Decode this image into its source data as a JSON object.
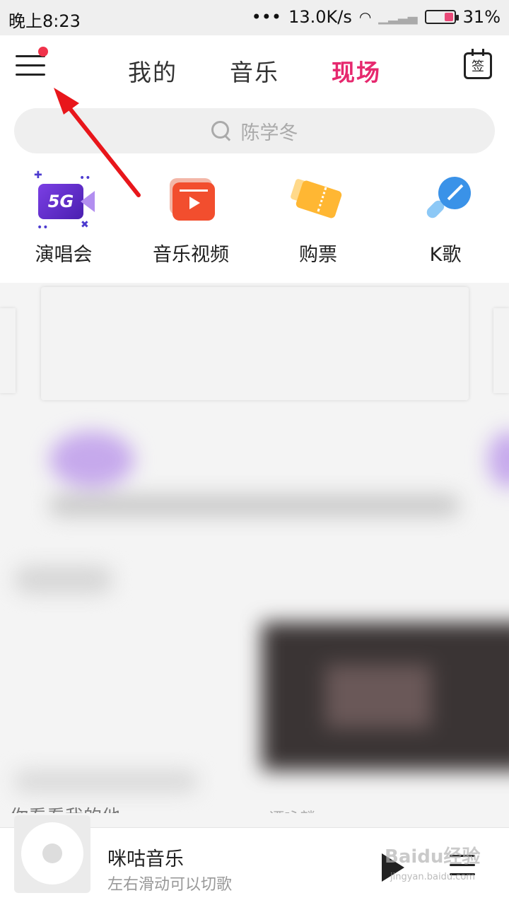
{
  "status_bar": {
    "time": "晚上8:23",
    "net_speed": "13.0K/s",
    "battery_percent": "31%",
    "battery_level": 0.31
  },
  "header": {
    "tabs": [
      {
        "label": "我的",
        "active": false
      },
      {
        "label": "音乐",
        "active": false
      },
      {
        "label": "现场",
        "active": true
      }
    ],
    "sign_label": "签",
    "accent_color": "#e6286e"
  },
  "search": {
    "placeholder": "陈学冬"
  },
  "shortcuts": [
    {
      "label": "演唱会",
      "icon": "5g-camera-icon",
      "badge": "5G"
    },
    {
      "label": "音乐视频",
      "icon": "video-play-icon"
    },
    {
      "label": "购票",
      "icon": "ticket-icon"
    },
    {
      "label": "K歌",
      "icon": "microphone-icon"
    }
  ],
  "partial_row": {
    "title": "你看看我的他",
    "artist": "谭咏麟"
  },
  "player": {
    "title": "咪咕音乐",
    "subtitle": "左右滑动可以切歌",
    "watermark": "Baidu经验",
    "watermark_url": "jingyan.baidu.com"
  }
}
